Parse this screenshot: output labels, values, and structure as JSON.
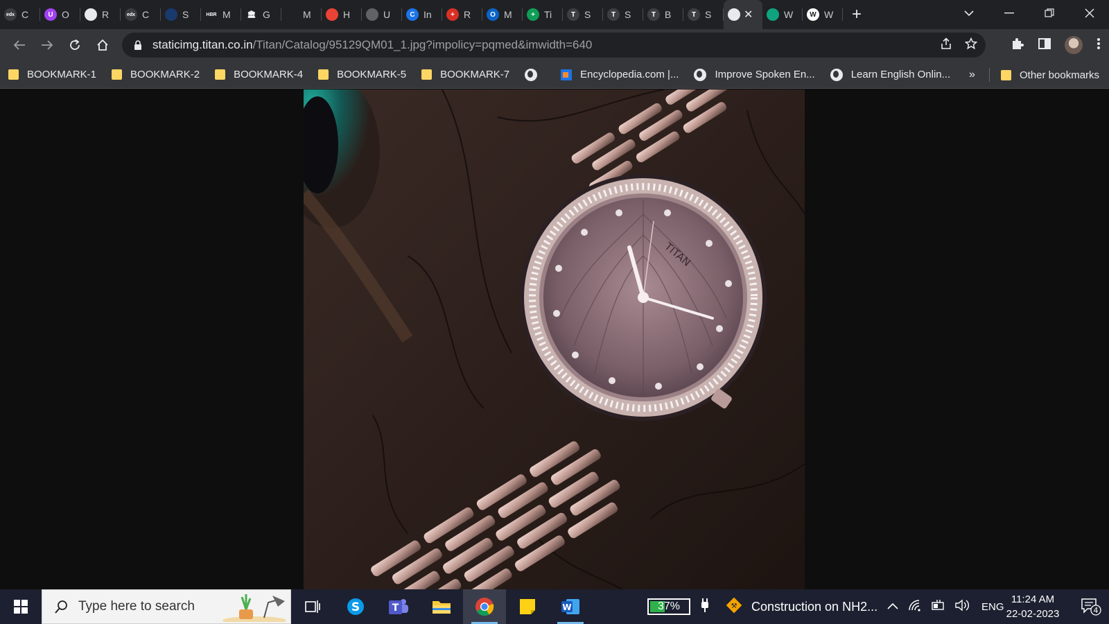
{
  "browser": {
    "tabs": [
      {
        "icon": "edx-icon",
        "title": "C",
        "color": "#3b3c40",
        "glyph": "edx"
      },
      {
        "icon": "purple-u-icon",
        "title": "O",
        "color": "#a142f4",
        "glyph": "U"
      },
      {
        "icon": "globe-icon",
        "title": "R",
        "color": "#e8eaed",
        "glyph": ""
      },
      {
        "icon": "edx-icon",
        "title": "C",
        "color": "#3b3c40",
        "glyph": "edx"
      },
      {
        "icon": "dots-icon",
        "title": "S",
        "color": "#1a3a6e",
        "glyph": ""
      },
      {
        "icon": "hbr-icon",
        "title": "M",
        "color": "#202124",
        "glyph": "HBR"
      },
      {
        "icon": "bank-icon",
        "title": "G",
        "color": "#202124",
        "glyph": "🏛"
      },
      {
        "icon": "blank-icon",
        "title": "M",
        "color": "#202124",
        "glyph": ""
      },
      {
        "icon": "pin-icon",
        "title": "H",
        "color": "#ea4335",
        "glyph": ""
      },
      {
        "icon": "image-icon",
        "title": "U",
        "color": "#5f6368",
        "glyph": ""
      },
      {
        "icon": "c-icon",
        "title": "In",
        "color": "#1a73e8",
        "glyph": "C"
      },
      {
        "icon": "red-cross-icon",
        "title": "R",
        "color": "#d93025",
        "glyph": "+"
      },
      {
        "icon": "outlook-icon",
        "title": "M",
        "color": "#0a64c8",
        "glyph": "O"
      },
      {
        "icon": "green-plus-icon",
        "title": "Ti",
        "color": "#0f9d58",
        "glyph": "+"
      },
      {
        "icon": "titan-icon",
        "title": "S",
        "color": "#3c4043",
        "glyph": "T"
      },
      {
        "icon": "titan-icon",
        "title": "S",
        "color": "#3c4043",
        "glyph": "T"
      },
      {
        "icon": "titan-icon",
        "title": "B",
        "color": "#3c4043",
        "glyph": "T"
      },
      {
        "icon": "titan-icon",
        "title": "S",
        "color": "#3c4043",
        "glyph": "T"
      },
      {
        "icon": "globe-icon",
        "title": "",
        "color": "#e8eaed",
        "glyph": "",
        "active": true
      },
      {
        "icon": "chatgpt-icon",
        "title": "W",
        "color": "#10a37f",
        "glyph": ""
      },
      {
        "icon": "wikipedia-icon",
        "title": "W",
        "color": "#ffffff",
        "glyph": "W"
      }
    ],
    "url_host": "staticimg.titan.co.in",
    "url_path": "/Titan/Catalog/95129QM01_1.jpg?impolicy=pqmed&imwidth=640",
    "bookmarks": [
      {
        "label": "BOOKMARK-1",
        "type": "folder"
      },
      {
        "label": "BOOKMARK-2",
        "type": "folder"
      },
      {
        "label": "BOOKMARK-4",
        "type": "folder"
      },
      {
        "label": "BOOKMARK-5",
        "type": "folder"
      },
      {
        "label": "BOOKMARK-7",
        "type": "folder"
      },
      {
        "label": "",
        "type": "globe"
      },
      {
        "label": "Encyclopedia.com |...",
        "type": "encyclopedia"
      },
      {
        "label": "Improve Spoken En...",
        "type": "globe"
      },
      {
        "label": "Learn English Onlin...",
        "type": "globe"
      }
    ],
    "bookmarks_more": "»",
    "other_bookmarks": "Other bookmarks"
  },
  "image": {
    "watch_brand": "TITAN"
  },
  "taskbar": {
    "search_placeholder": "Type here to search",
    "battery_percent": "37%",
    "battery_level": 0.37,
    "news": "Construction on NH2...",
    "language": "ENG",
    "time": "11:24 AM",
    "date": "22-02-2023",
    "notification_count": "4"
  }
}
